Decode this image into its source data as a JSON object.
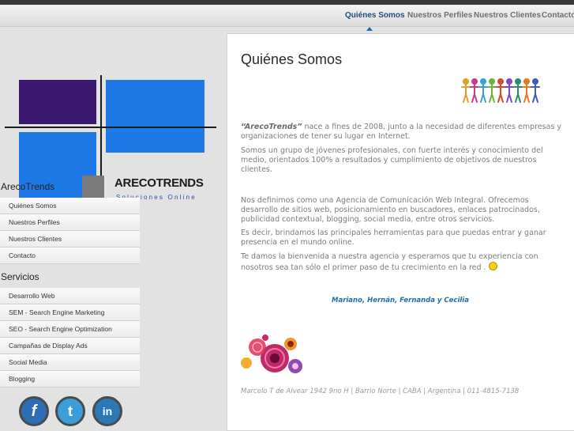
{
  "topnav": {
    "items": [
      {
        "label": "Quiénes Somos"
      },
      {
        "label": "Nuestros Perfiles"
      },
      {
        "label": "Nuestros Clientes"
      },
      {
        "label": "Contacto"
      }
    ]
  },
  "logo": {
    "name": "ARECOTRENDS",
    "tagline": "Soluciones Online"
  },
  "sidebar": {
    "heading1": "ArecoTrends",
    "menu1": [
      {
        "label": "Quiénes Somos"
      },
      {
        "label": "Nuestros Perfiles"
      },
      {
        "label": "Nuestros Clientes"
      },
      {
        "label": "Contacto"
      }
    ],
    "heading2": "Servicios",
    "menu2": [
      {
        "label": "Desarrollo Web"
      },
      {
        "label": "SEM - Search Engine Marketing"
      },
      {
        "label": "SEO - Search Engine Optimization"
      },
      {
        "label": "Campañas de Display Ads"
      },
      {
        "label": "Social Media"
      },
      {
        "label": "Blogging"
      }
    ],
    "social": [
      {
        "icon": "facebook-icon",
        "glyph": "f",
        "color": "#2d6db5"
      },
      {
        "icon": "twitter-icon",
        "glyph": "t",
        "color": "#3a9fd8"
      },
      {
        "icon": "linkedin-icon",
        "glyph": "in",
        "color": "#2a78b8"
      }
    ]
  },
  "content": {
    "title": "Quiénes Somos",
    "p1_brand": "“ArecoTrends”",
    "p1_rest": " nace a fines de 2008, junto a la necesidad de diferentes empresas y organizaciones de tener su lugar en Internet.",
    "p2": "Somos un grupo de jóvenes profesionales, con fuerte interés y conocimiento del medio, orientados 100% a resultados y cumplimiento de objetivos de nuestros clientes.",
    "p3": "Nos definimos como una Agencia de Comunicación Web Integral. Ofrecemos desarrollo de sitios web, posicionamiento en buscadores, enlaces patrocinados, publicidad contextual, blogging, social media, entre otros servicios.",
    "p4": "Es decir, brindamos las principales herramientas para que puedas entrar y ganar presencia en el mundo online.",
    "p5": "Te damos la bienvenida a nuestra agencia y esperamos que tu experiencia con nosotros sea tan sólo el primer paso de tu crecimiento en la red .",
    "signature": "Mariano, Hernán, Fernanda y Cecilia",
    "address": "Marcelo T de Alvear 1942  9no H | Barrio Norte | CABA | Argentina | 011-4815-7138"
  },
  "colors": {
    "accent": "#1f6aa8",
    "logo_purple": "#3b1770",
    "logo_blue": "#1e78e6",
    "signature": "#1e6fb0"
  }
}
